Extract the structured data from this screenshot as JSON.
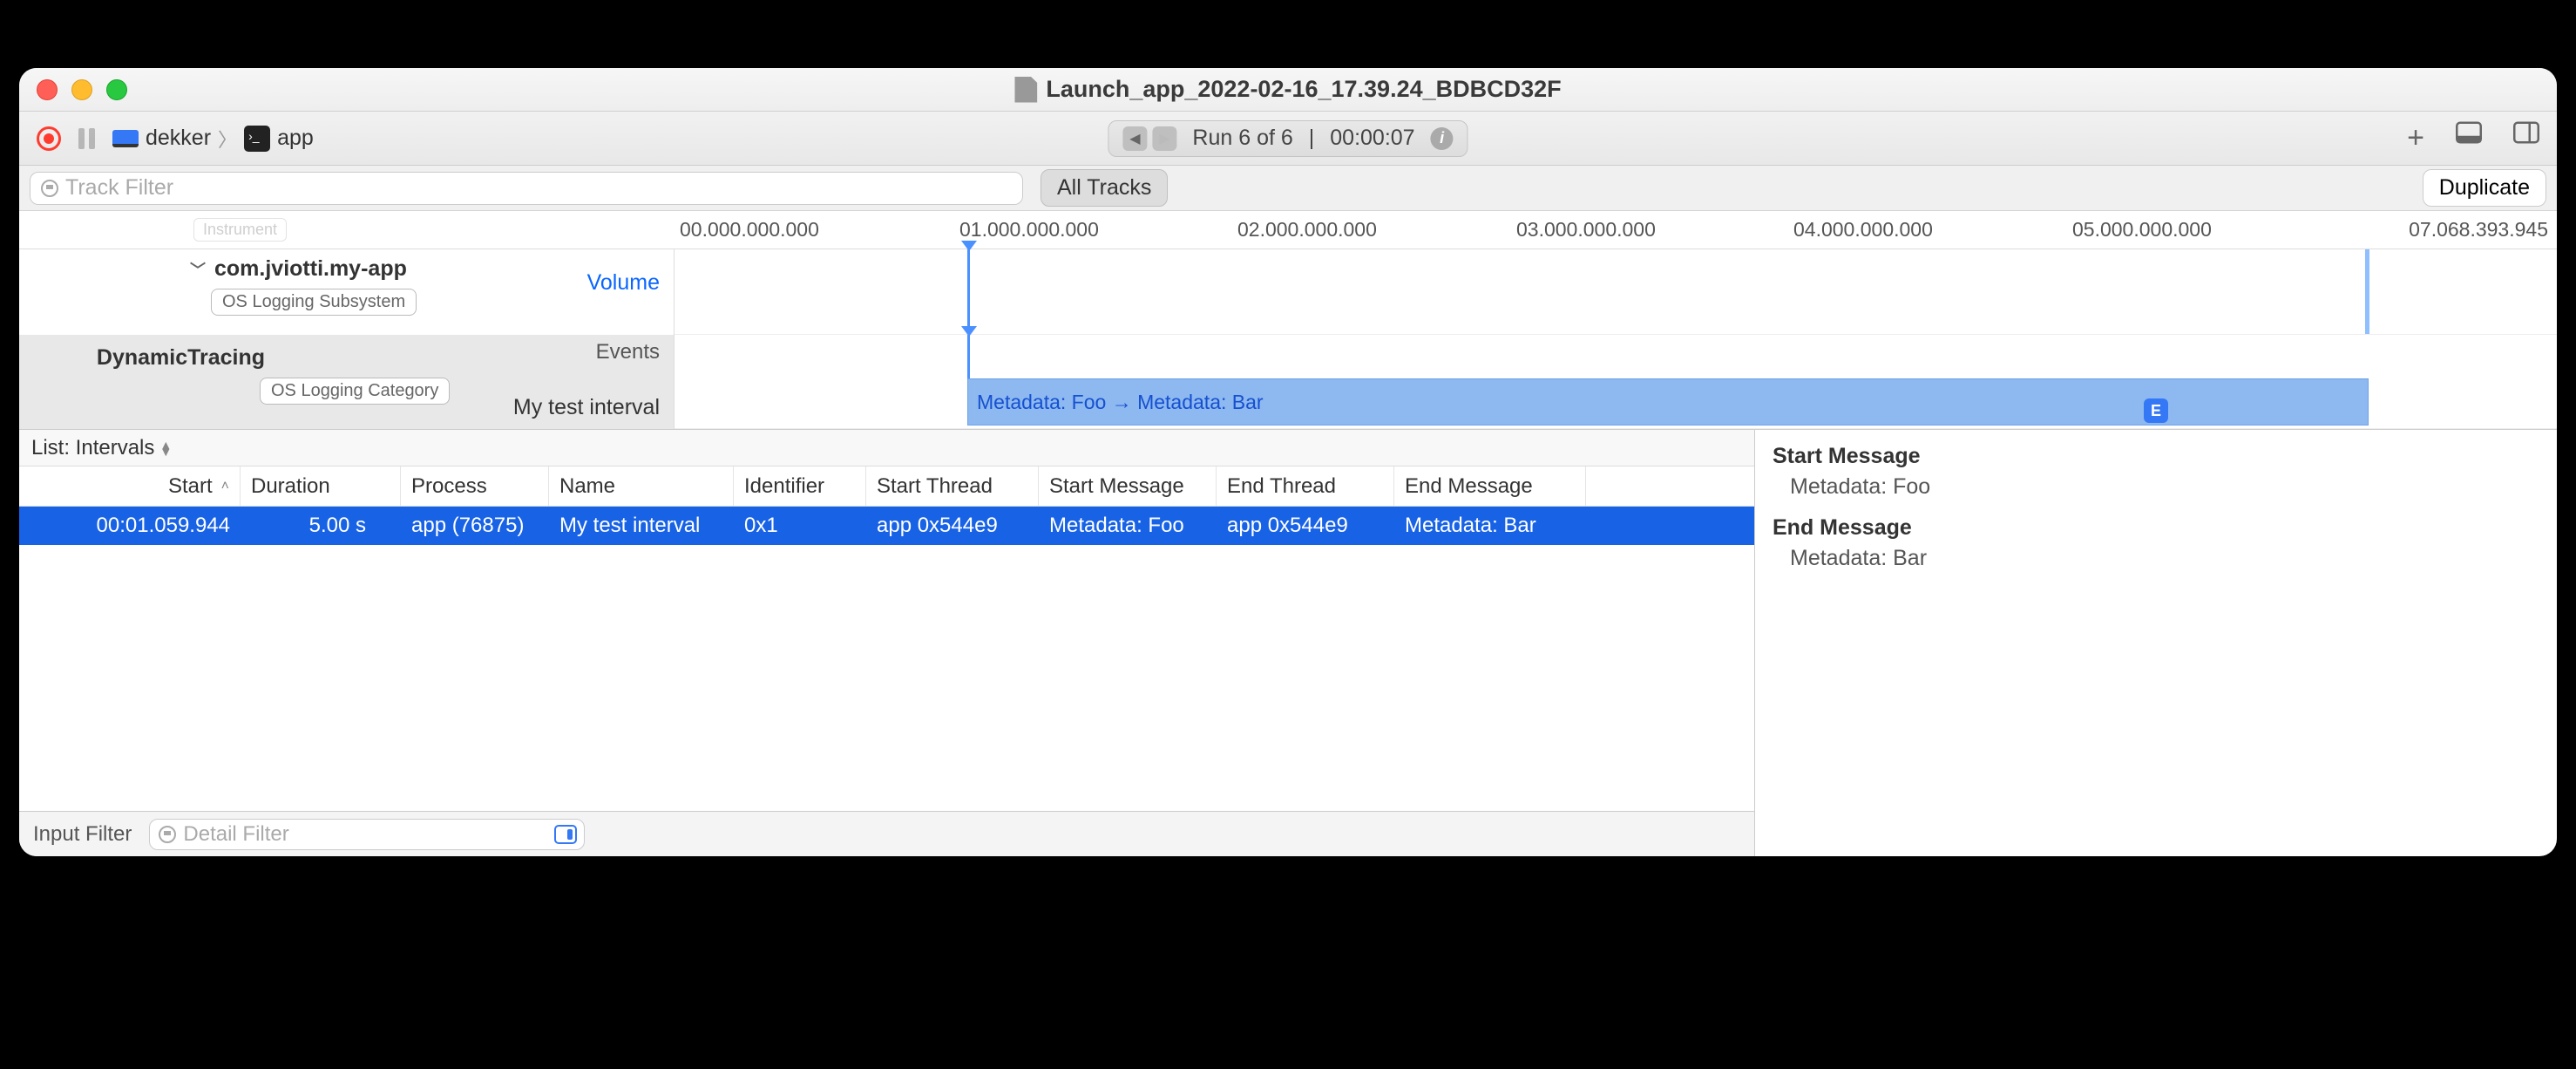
{
  "window": {
    "title": "Launch_app_2022-02-16_17.39.24_BDBCD32F"
  },
  "toolbar": {
    "device": "dekker",
    "target": "app",
    "run_label": "Run 6 of 6",
    "run_time": "00:00:07"
  },
  "filterbar": {
    "track_filter_placeholder": "Track Filter",
    "all_tracks": "All Tracks",
    "duplicate": "Duplicate"
  },
  "ruler": {
    "t0": "00.000.000.000",
    "t1": "01.000.000.000",
    "t2": "02.000.000.000",
    "t3": "03.000.000.000",
    "t4": "04.000.000.000",
    "t5": "05.000.000.000",
    "tend": "07.068.393.945",
    "instrument_badge": "Instrument"
  },
  "tracks": {
    "subsystem": {
      "name": "com.jviotti.my-app",
      "badge": "OS Logging Subsystem",
      "metric": "Volume"
    },
    "category": {
      "name": "DynamicTracing",
      "badge": "OS Logging Category",
      "events_label": "Events",
      "interval_label": "My test interval",
      "interval_bar_text": "Metadata: Foo → Metadata: Bar"
    }
  },
  "detail": {
    "list_label": "List: Intervals",
    "columns": {
      "start": "Start",
      "duration": "Duration",
      "process": "Process",
      "name": "Name",
      "identifier": "Identifier",
      "start_thread": "Start Thread",
      "start_message": "Start Message",
      "end_thread": "End Thread",
      "end_message": "End Message"
    },
    "row": {
      "start": "00:01.059.944",
      "duration": "5.00 s",
      "process": "app (76875)",
      "name": "My test interval",
      "identifier": "0x1",
      "start_thread": "app  0x544e9",
      "start_message": "Metadata: Foo",
      "end_thread": "app  0x544e9",
      "end_message": "Metadata: Bar"
    },
    "inspector": {
      "e_badge": "E",
      "start_msg_title": "Start Message",
      "start_msg_val": "Metadata: Foo",
      "end_msg_title": "End Message",
      "end_msg_val": "Metadata: Bar"
    }
  },
  "bottombar": {
    "input_filter": "Input Filter",
    "detail_filter_placeholder": "Detail Filter"
  }
}
